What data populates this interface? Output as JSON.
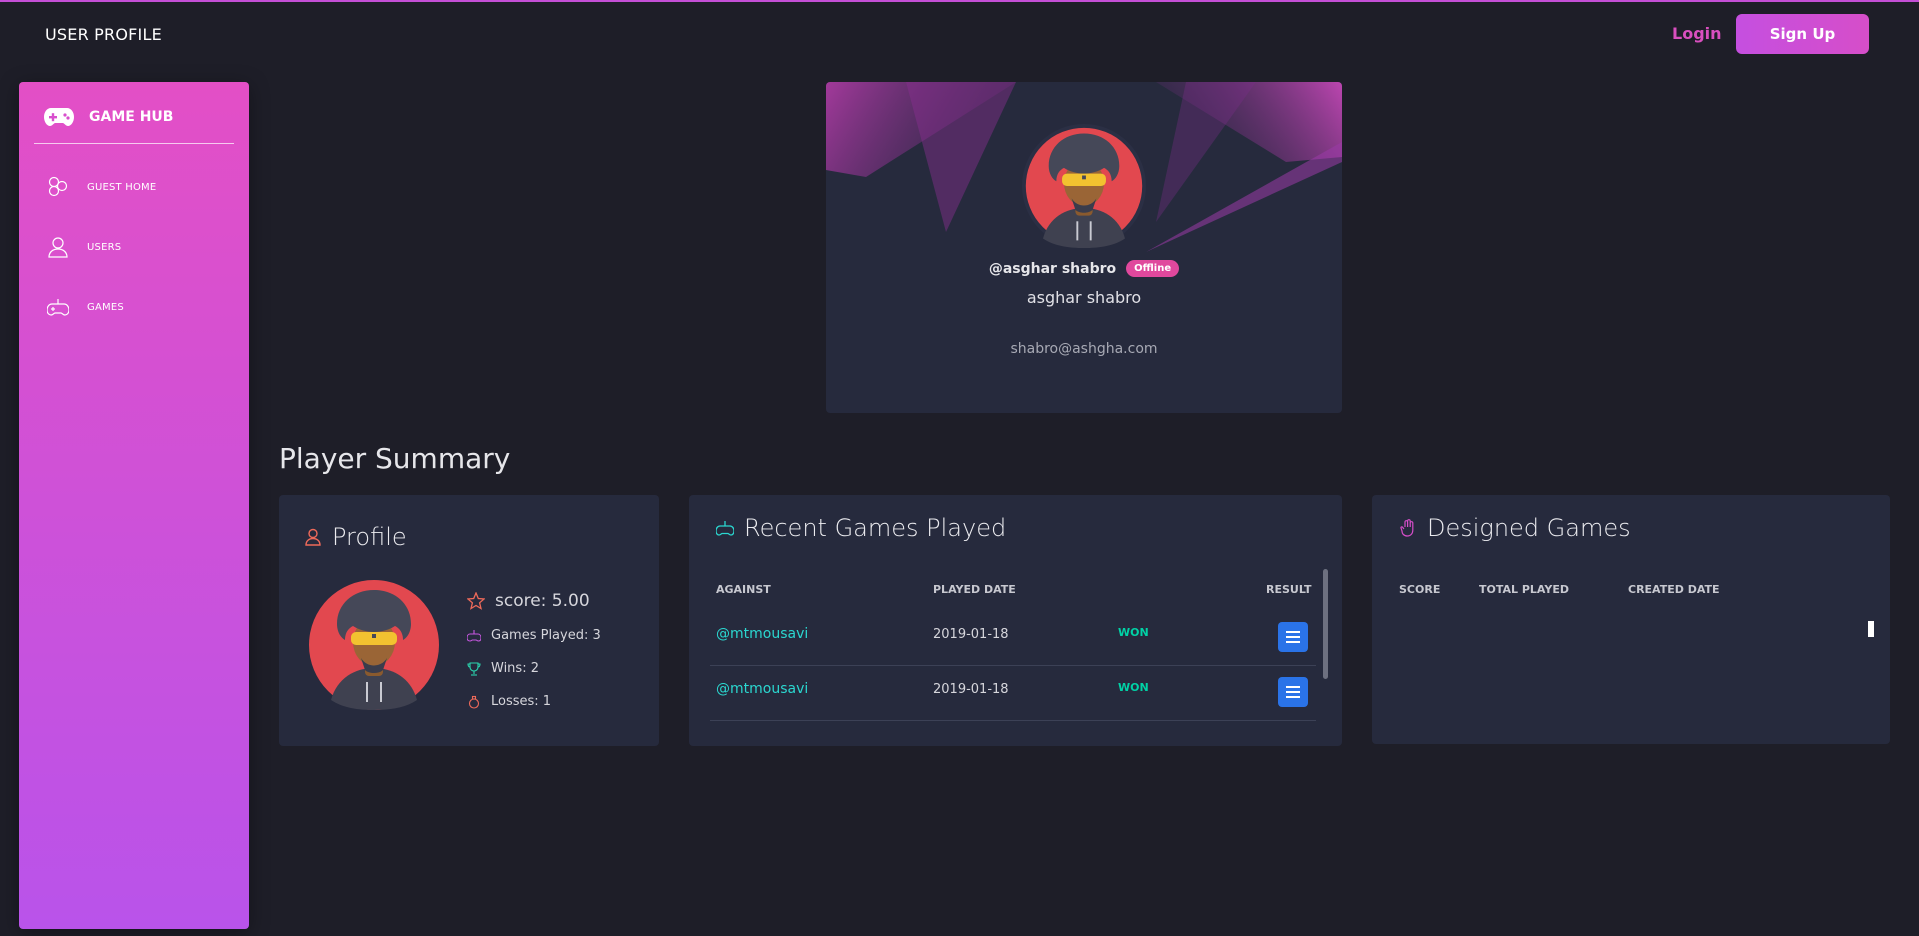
{
  "navbar": {
    "title": "USER PROFILE",
    "login_label": "Login",
    "signup_label": "Sign Up"
  },
  "sidebar": {
    "brand": "GAME HUB",
    "items": [
      {
        "label": "GUEST HOME",
        "icon": "hexagons-icon"
      },
      {
        "label": "USERS",
        "icon": "user-icon"
      },
      {
        "label": "GAMES",
        "icon": "gamepad-icon"
      }
    ]
  },
  "profile_card": {
    "handle": "@asghar shabro",
    "status": "Offline",
    "full_name": "asghar shabro",
    "email": "shabro@ashgha.com"
  },
  "summary": {
    "title": "Player Summary",
    "profile": {
      "heading": "Profile",
      "score": "score: 5.00",
      "games_played": "Games Played: 3",
      "wins": "Wins: 2",
      "losses": "Losses: 1"
    },
    "recent_games": {
      "heading": "Recent Games Played",
      "columns": [
        "AGAINST",
        "PLAYED DATE",
        "RESULT"
      ],
      "rows": [
        {
          "against": "@mtmousavi",
          "date": "2019-01-18",
          "result": "WON"
        },
        {
          "against": "@mtmousavi",
          "date": "2019-01-18",
          "result": "WON"
        }
      ]
    },
    "designed_games": {
      "heading": "Designed Games",
      "columns": [
        "SCORE",
        "TOTAL PLAYED",
        "CREATED DATE"
      ]
    }
  },
  "colors": {
    "accent_pink": "#d94fbf",
    "sidebar_top": "#e34fc6",
    "sidebar_bottom": "#b953ea",
    "card_bg": "#262a3d",
    "page_bg": "#1e1e28",
    "link_teal": "#2bd7d0",
    "won_green": "#00d2a6",
    "badge_pink": "#e0489d",
    "button_blue": "#2a73e8"
  }
}
